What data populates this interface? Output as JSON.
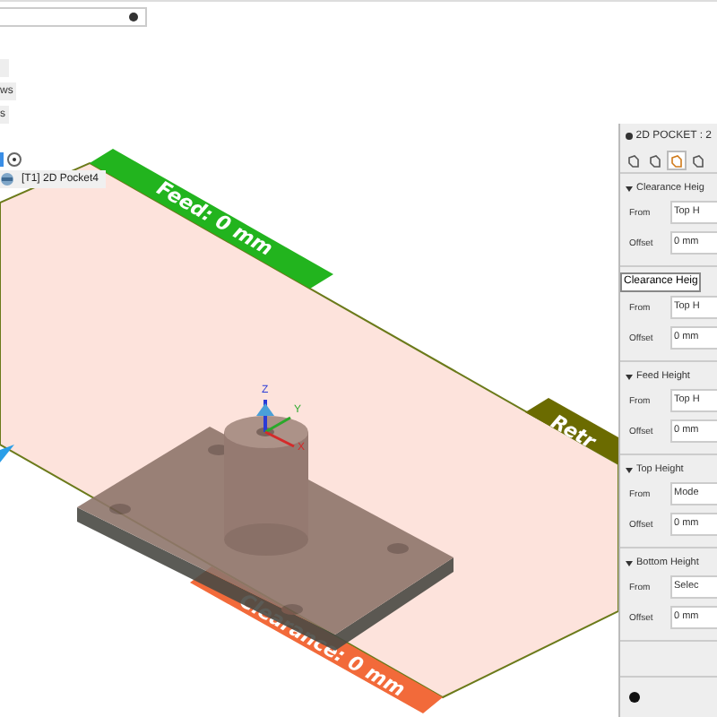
{
  "browser_items": [
    {
      "label": "ws"
    },
    {
      "label": "s"
    }
  ],
  "operation_tab": {
    "label": "[T1] 2D Pocket4"
  },
  "viewport": {
    "heights": [
      {
        "kind": "feed",
        "label": "Feed: 0 mm"
      },
      {
        "kind": "retract",
        "label": "Retr"
      },
      {
        "kind": "clearance",
        "label": "Clearance: 0 mm"
      }
    ],
    "axes": [
      {
        "label": "Z"
      },
      {
        "label": "Y"
      },
      {
        "label": "X"
      }
    ]
  },
  "panel": {
    "title": "2D POCKET : 2",
    "tabs": [
      {
        "selected": false
      },
      {
        "selected": false
      },
      {
        "selected": true
      },
      {
        "selected": false
      }
    ],
    "sections": [
      {
        "kind": "group",
        "title": "Clearance Heig",
        "expanded": true,
        "fields": [
          {
            "label": "From",
            "value": "Top H"
          },
          {
            "label": "Offset",
            "value": "0 mm"
          }
        ]
      },
      {
        "kind": "tooltip",
        "title": "Clearance Heig",
        "fields": [
          {
            "label": "From",
            "value": "Top H"
          },
          {
            "label": "Offset",
            "value": "0 mm"
          }
        ]
      },
      {
        "kind": "group",
        "title": "Feed Height",
        "expanded": true,
        "fields": [
          {
            "label": "From",
            "value": "Top H"
          },
          {
            "label": "Offset",
            "value": "0 mm"
          }
        ]
      },
      {
        "kind": "group",
        "title": "Top Height",
        "expanded": true,
        "fields": [
          {
            "label": "From",
            "value": "Mode"
          },
          {
            "label": "Offset",
            "value": "0 mm"
          }
        ]
      },
      {
        "kind": "group",
        "title": "Bottom Height",
        "expanded": true,
        "fields": [
          {
            "label": "From",
            "value": "Selec"
          },
          {
            "label": "Offset",
            "value": "0 mm"
          }
        ]
      }
    ]
  }
}
